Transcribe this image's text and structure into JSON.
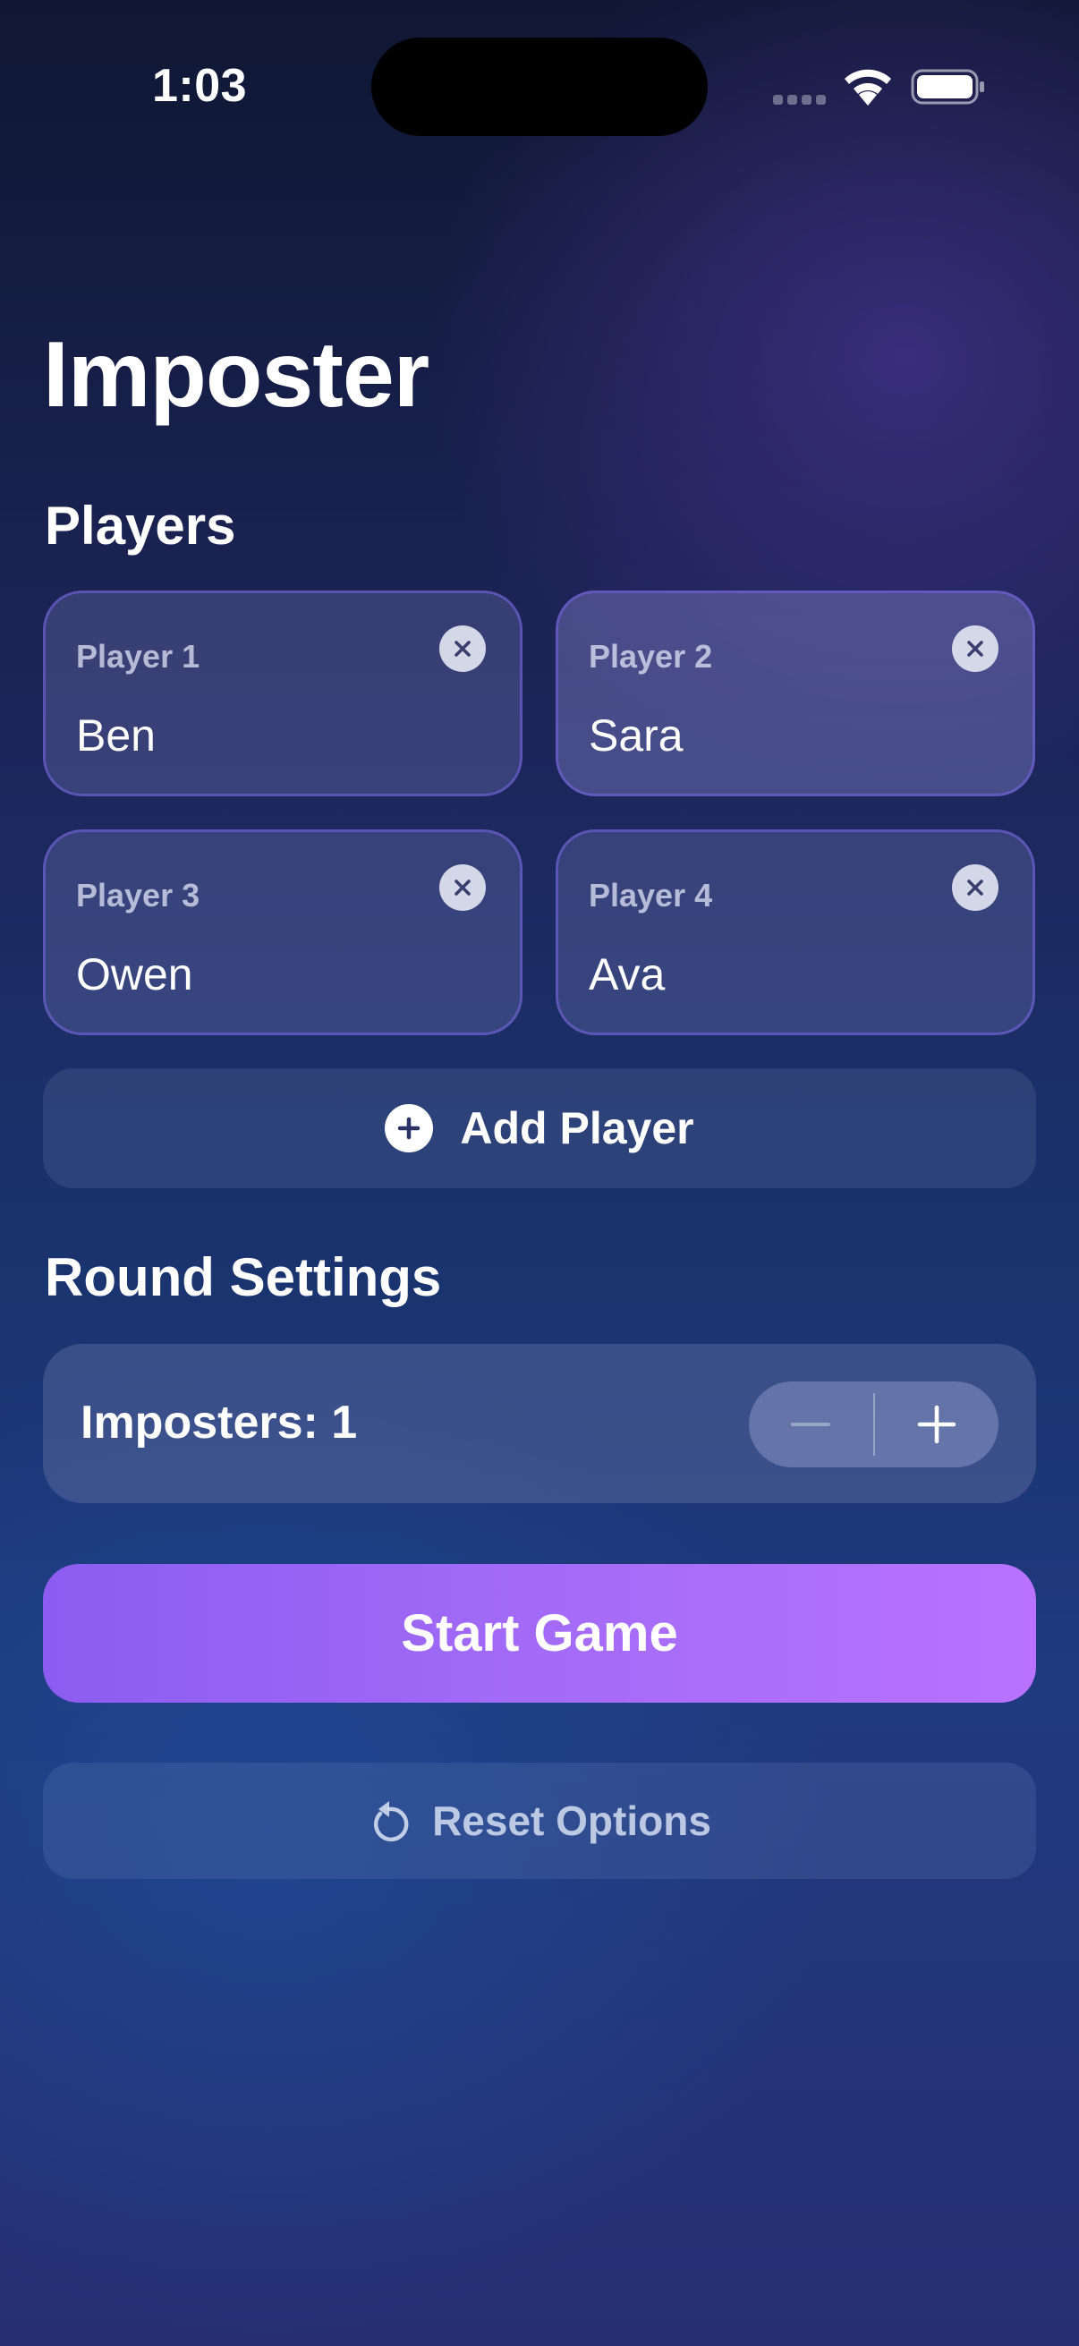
{
  "status_bar": {
    "time": "1:03"
  },
  "app": {
    "title": "Imposter"
  },
  "players_section": {
    "title": "Players",
    "players": [
      {
        "label": "Player 1",
        "name": "Ben"
      },
      {
        "label": "Player 2",
        "name": "Sara"
      },
      {
        "label": "Player 3",
        "name": "Owen"
      },
      {
        "label": "Player 4",
        "name": "Ava"
      }
    ],
    "add_player_label": "Add Player"
  },
  "round_settings": {
    "title": "Round Settings",
    "imposters_label": "Imposters: 1"
  },
  "actions": {
    "start_label": "Start Game",
    "reset_label": "Reset Options"
  },
  "icons": {
    "remove": "close-circle-icon",
    "add": "plus-circle-icon",
    "reset": "reset-arrow-icon",
    "decrement": "minus-icon",
    "increment": "plus-icon"
  },
  "colors": {
    "accent_start": "#8c5cf0",
    "accent_end": "#b872ff"
  }
}
